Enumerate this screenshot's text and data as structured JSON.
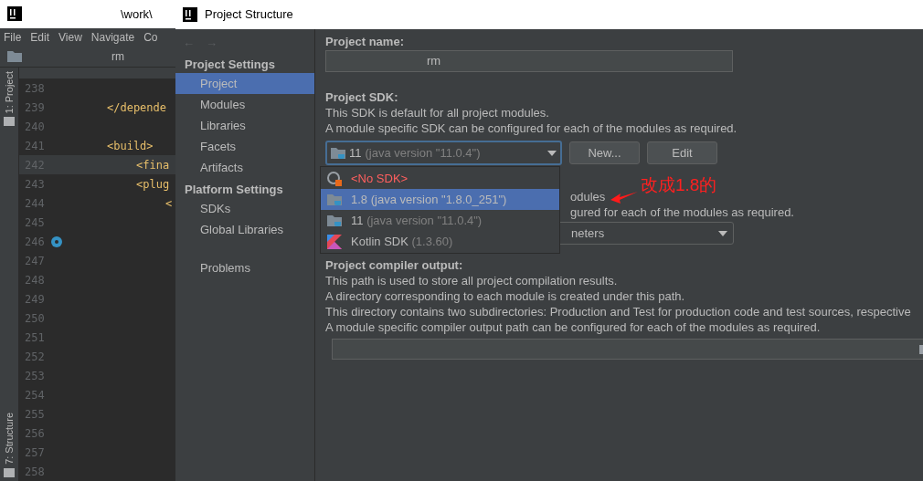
{
  "ide": {
    "title_fragment": "\\work\\",
    "menu": [
      "File",
      "Edit",
      "View",
      "Navigate",
      "Co"
    ],
    "nav_fragment": "rm",
    "tool_windows": [
      {
        "label": "1: Project"
      },
      {
        "label": "7: Structure"
      }
    ],
    "code_lines": [
      {
        "number": "238",
        "current": false
      },
      {
        "number": "239",
        "code": "</depende",
        "current": false
      },
      {
        "number": "240",
        "current": false
      },
      {
        "number": "241",
        "code": "<build>",
        "current": false
      },
      {
        "number": "242",
        "code": "<fina",
        "current": true
      },
      {
        "number": "243",
        "code": "<plug",
        "current": false
      },
      {
        "number": "244",
        "code": "<",
        "current": false
      },
      {
        "number": "245",
        "current": false
      },
      {
        "number": "246",
        "current": false
      },
      {
        "number": "247",
        "current": false
      },
      {
        "number": "248",
        "current": false
      },
      {
        "number": "249",
        "current": false
      },
      {
        "number": "250",
        "current": false
      },
      {
        "number": "251",
        "current": false
      },
      {
        "number": "252",
        "current": false
      },
      {
        "number": "253",
        "current": false
      },
      {
        "number": "254",
        "current": false
      },
      {
        "number": "255",
        "current": false
      },
      {
        "number": "256",
        "current": false
      },
      {
        "number": "257",
        "current": false
      },
      {
        "number": "258",
        "current": false
      }
    ]
  },
  "dialog": {
    "title": "Project Structure",
    "nav": [
      "←",
      "→"
    ],
    "sidebar": [
      {
        "heading": "Project Settings",
        "items": [
          {
            "label": "Project",
            "selected": true
          },
          {
            "label": "Modules",
            "selected": false
          },
          {
            "label": "Libraries",
            "selected": false
          },
          {
            "label": "Facets",
            "selected": false
          },
          {
            "label": "Artifacts",
            "selected": false
          }
        ]
      },
      {
        "heading": "Platform Settings",
        "items": [
          {
            "label": "SDKs",
            "selected": false
          },
          {
            "label": "Global Libraries",
            "selected": false
          }
        ]
      },
      {
        "items": [
          {
            "label": "Problems",
            "selected": false
          }
        ]
      }
    ],
    "project_name": {
      "label": "Project name:",
      "value": "rm"
    },
    "project_sdk": {
      "label": "Project SDK:",
      "lines": [
        "This SDK is default for all project modules.",
        "A module specific SDK can be configured for each of the modules as required."
      ],
      "selected": {
        "name": "11",
        "detail": "(java version \"11.0.4\")"
      },
      "buttons": [
        "New...",
        "Edit"
      ],
      "options": [
        {
          "kind": "none",
          "name": "<No SDK>",
          "selected": false
        },
        {
          "kind": "jdk",
          "name": "1.8",
          "detail": "(java version \"1.8.0_251\")",
          "selected": true
        },
        {
          "kind": "jdk",
          "name": "11",
          "detail": "(java version \"11.0.4\")",
          "selected": false
        },
        {
          "kind": "kotlin",
          "name": "Kotlin SDK",
          "detail": "(1.3.60)",
          "selected": false
        }
      ]
    },
    "language_level": {
      "fragments": [
        "odules",
        "gured for each of the modules as required."
      ],
      "value_fragment": "neters"
    },
    "compiler_output": {
      "label": "Project compiler output:",
      "lines": [
        "This path is used to store all project compilation results.",
        "A directory corresponding to each module is created under this path.",
        "This directory contains two subdirectories: Production and Test for production code and test sources, respective",
        "A module specific compiler output path can be configured for each of the modules as required."
      ]
    }
  },
  "annotation": {
    "text": "改成1.8的"
  }
}
